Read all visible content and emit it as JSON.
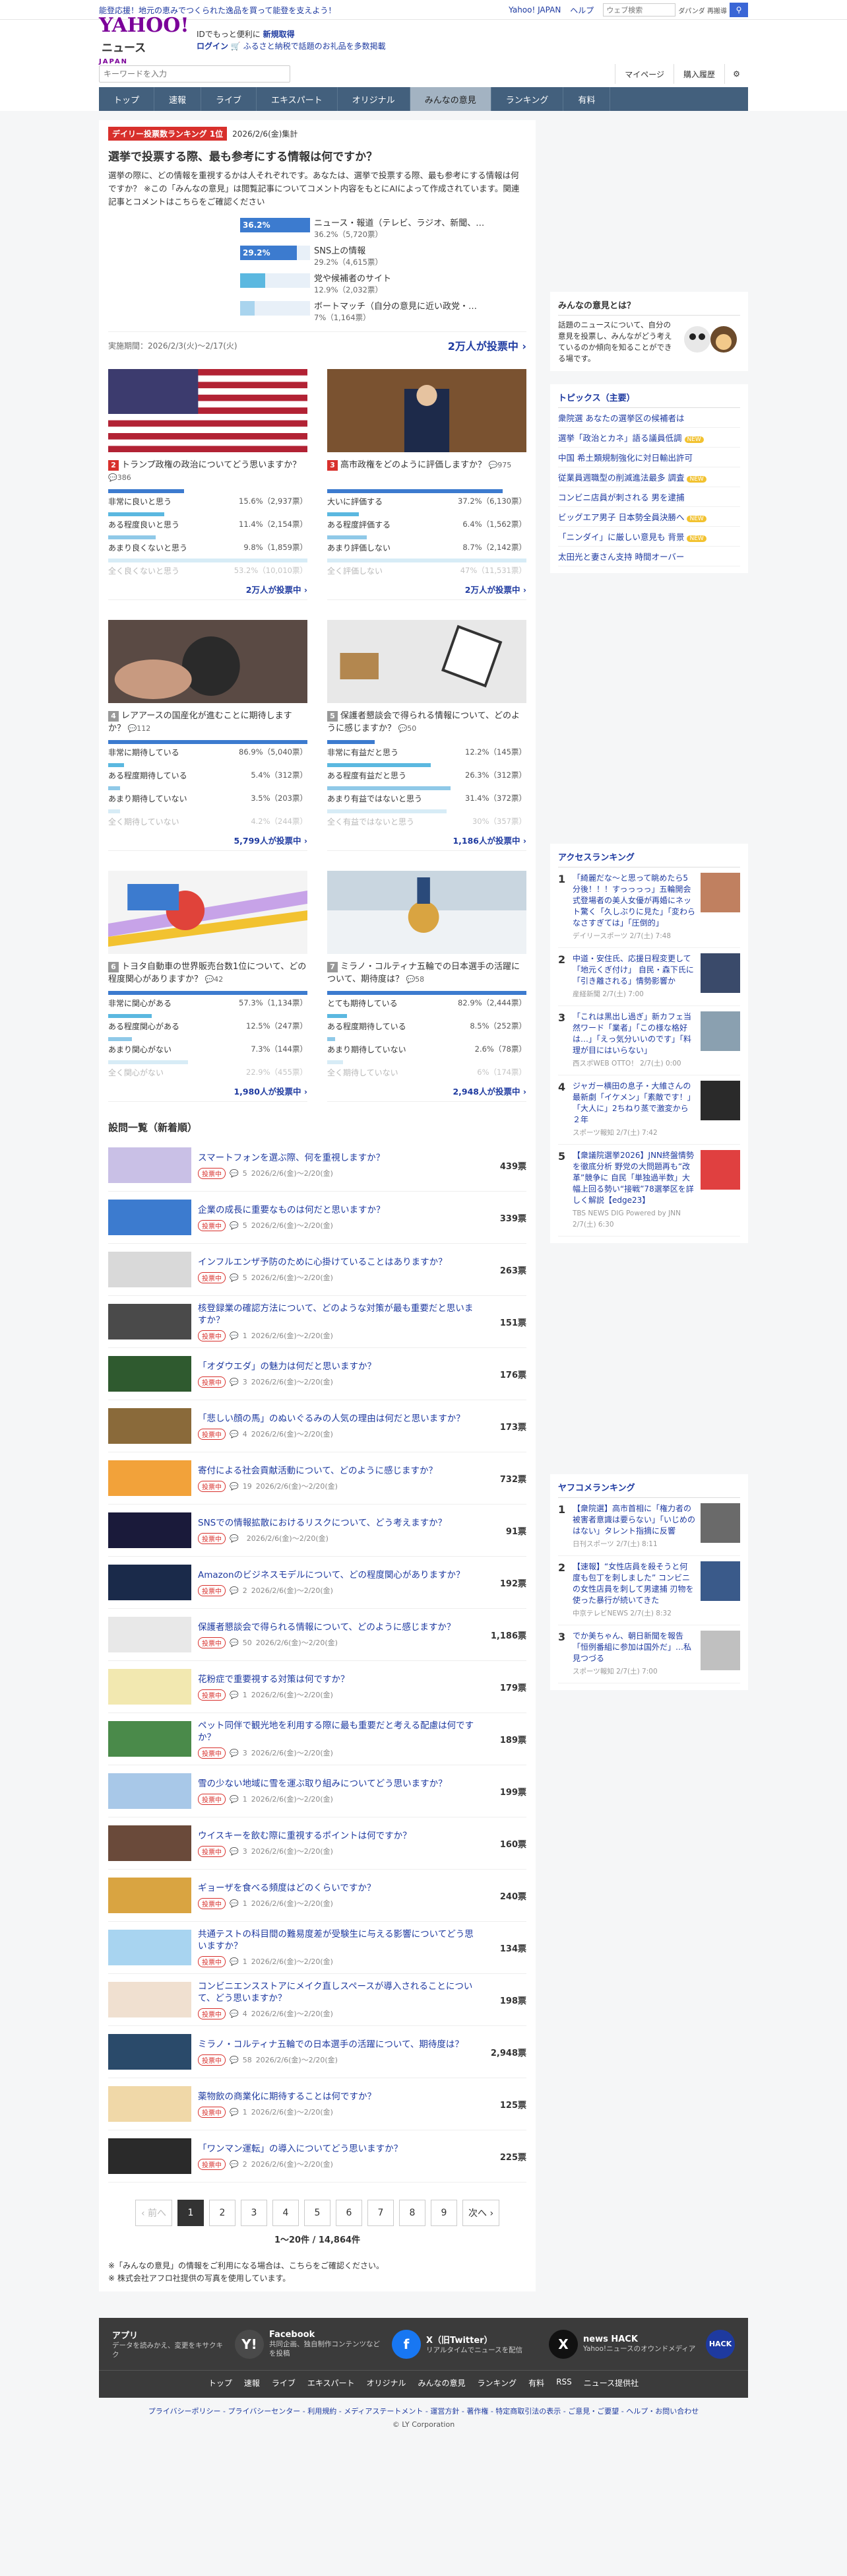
{
  "topbar": {
    "promo": "能登応援！地元の恵みでつくられた逸品を買って能登を支えよう！",
    "yahoo_japan": "Yahoo! JAPAN",
    "help": "ヘルプ",
    "search_placeholder": "ウェブ検索",
    "keyword": "ダパンダ 再搬導"
  },
  "header": {
    "logo_main": "YAHOO!",
    "logo_news": "ニュース",
    "logo_sub": "JAPAN",
    "tagline": "IDでもっと便利に",
    "signup": "新規取得",
    "login": "ログイン",
    "furusato": "ふるさと納税で話題のお礼品を多数掲載"
  },
  "search": {
    "placeholder": "キーワードを入力",
    "mypage": "マイページ",
    "history": "購入履歴"
  },
  "nav": [
    "トップ",
    "速報",
    "ライブ",
    "エキスパート",
    "オリジナル",
    "みんなの意見",
    "ランキング",
    "有料"
  ],
  "nav_active": 5,
  "featured": {
    "tag": "デイリー投票数ランキング 1位",
    "date": "2026/2/6(金)集計",
    "title": "選挙で投票する際、最も参考にする情報は何ですか？",
    "desc": "選挙の際に、どの情報を重視するかは人それぞれです。あなたは、選挙で投票する際、最も参考にする情報は何ですか？ ※この「みんなの意見」は閲覧記事についてコメント内容をもとにAIによって作成されています。関連記事とコメントはこちらをご確認ください",
    "options": [
      {
        "pct": "36.2%",
        "pct_num": 36.2,
        "label": "ニュース・報道（テレビ、ラジオ、新聞、…",
        "sub": "36.2%（5,720票）"
      },
      {
        "pct": "29.2%",
        "pct_num": 29.2,
        "label": "SNS上の情報",
        "sub": "29.2%（4,615票）"
      },
      {
        "pct": "",
        "pct_num": 12.9,
        "label": "党や候補者のサイト",
        "sub": "12.9%（2,032票）"
      },
      {
        "pct": "",
        "pct_num": 7.4,
        "label": "ボートマッチ（自分の意見に近い政党・…",
        "sub": "7%（1,164票）"
      }
    ],
    "period": "実施期間：2026/2/3(火)〜2/17(火)",
    "cta": "2万人が投票中 ›"
  },
  "cards": [
    {
      "num": "2",
      "title": "トランプ政権の政治についてどう思いますか？",
      "count": "386",
      "rows": [
        {
          "l": "非常に良いと思う",
          "p": "15.6%（2,937票）",
          "w": 38
        },
        {
          "l": "ある程度良いと思う",
          "p": "11.4%（2,154票）",
          "w": 28
        },
        {
          "l": "あまり良くないと思う",
          "p": "9.8%（1,859票）",
          "w": 24
        },
        {
          "l": "全く良くないと思う",
          "p": "53.2%（10,010票）",
          "w": 100
        }
      ],
      "cta": "2万人が投票中 ›"
    },
    {
      "num": "3",
      "title": "高市政権をどのように評価しますか？",
      "count": "975",
      "rows": [
        {
          "l": "大いに評価する",
          "p": "37.2%（6,130票）",
          "w": 88
        },
        {
          "l": "ある程度評価する",
          "p": "6.4%（1,562票）",
          "w": 16
        },
        {
          "l": "あまり評価しない",
          "p": "8.7%（2,142票）",
          "w": 20
        },
        {
          "l": "全く評価しない",
          "p": "47%（11,531票）",
          "w": 100
        }
      ],
      "cta": "2万人が投票中 ›"
    },
    {
      "num": "4",
      "title": "レアアースの国産化が進むことに期待しますか？",
      "count": "112",
      "rows": [
        {
          "l": "非常に期待している",
          "p": "86.9%（5,040票）",
          "w": 100
        },
        {
          "l": "ある程度期待している",
          "p": "5.4%（312票）",
          "w": 8
        },
        {
          "l": "あまり期待していない",
          "p": "3.5%（203票）",
          "w": 6
        },
        {
          "l": "全く期待していない",
          "p": "4.2%（244票）",
          "w": 6
        }
      ],
      "cta": "5,799人が投票中 ›"
    },
    {
      "num": "5",
      "title": "保護者懇談会で得られる情報について、どのように感じますか？",
      "count": "50",
      "rows": [
        {
          "l": "非常に有益だと思う",
          "p": "12.2%（145票）",
          "w": 24
        },
        {
          "l": "ある程度有益だと思う",
          "p": "26.3%（312票）",
          "w": 52
        },
        {
          "l": "あまり有益ではないと思う",
          "p": "31.4%（372票）",
          "w": 62
        },
        {
          "l": "全く有益ではないと思う",
          "p": "30%（357票）",
          "w": 60
        }
      ],
      "cta": "1,186人が投票中 ›"
    },
    {
      "num": "6",
      "title": "トヨタ自動車の世界販売台数1位について、どの程度関心がありますか？",
      "count": "42",
      "rows": [
        {
          "l": "非常に関心がある",
          "p": "57.3%（1,134票）",
          "w": 100
        },
        {
          "l": "ある程度関心がある",
          "p": "12.5%（247票）",
          "w": 22
        },
        {
          "l": "あまり関心がない",
          "p": "7.3%（144票）",
          "w": 12
        },
        {
          "l": "全く関心がない",
          "p": "22.9%（455票）",
          "w": 40
        }
      ],
      "cta": "1,980人が投票中 ›"
    },
    {
      "num": "7",
      "title": "ミラノ・コルティナ五輪での日本選手の活躍について、期待度は？",
      "count": "58",
      "rows": [
        {
          "l": "とても期待している",
          "p": "82.9%（2,444票）",
          "w": 100
        },
        {
          "l": "ある程度期待している",
          "p": "8.5%（252票）",
          "w": 10
        },
        {
          "l": "あまり期待していない",
          "p": "2.6%（78票）",
          "w": 4
        },
        {
          "l": "全く期待していない",
          "p": "6%（174票）",
          "w": 8
        }
      ],
      "cta": "2,948人が投票中 ›"
    }
  ],
  "list_heading": "設問一覧（新着順）",
  "badge": "投票中",
  "list": [
    {
      "t": "スマートフォンを選ぶ際、何を重視しますか？",
      "c": "5",
      "d": "2026/2/6(金)〜2/20(金)",
      "v": "439票"
    },
    {
      "t": "企業の成長に重要なものは何だと思いますか？",
      "c": "5",
      "d": "2026/2/6(金)〜2/20(金)",
      "v": "339票"
    },
    {
      "t": "インフルエンザ予防のために心掛けていることはありますか？",
      "c": "5",
      "d": "2026/2/6(金)〜2/20(金)",
      "v": "263票"
    },
    {
      "t": "核登録業の確認方法について、どのような対策が最も重要だと思いますか？",
      "c": "1",
      "d": "2026/2/6(金)〜2/20(金)",
      "v": "151票"
    },
    {
      "t": "「オダウエダ」の魅力は何だと思いますか？",
      "c": "3",
      "d": "2026/2/6(金)〜2/20(金)",
      "v": "176票"
    },
    {
      "t": "「悲しい顔の馬」のぬいぐるみの人気の理由は何だと思いますか？",
      "c": "4",
      "d": "2026/2/6(金)〜2/20(金)",
      "v": "173票"
    },
    {
      "t": "寄付による社会貢献活動について、どのように感じますか？",
      "c": "19",
      "d": "2026/2/6(金)〜2/20(金)",
      "v": "732票"
    },
    {
      "t": "SNSでの情報拡散におけるリスクについて、どう考えますか？",
      "c": "",
      "d": "2026/2/6(金)〜2/20(金)",
      "v": "91票"
    },
    {
      "t": "Amazonのビジネスモデルについて、どの程度関心がありますか？",
      "c": "2",
      "d": "2026/2/6(金)〜2/20(金)",
      "v": "192票"
    },
    {
      "t": "保護者懇談会で得られる情報について、どのように感じますか？",
      "c": "50",
      "d": "2026/2/6(金)〜2/20(金)",
      "v": "1,186票"
    },
    {
      "t": "花粉症で重要視する対策は何ですか？",
      "c": "1",
      "d": "2026/2/6(金)〜2/20(金)",
      "v": "179票"
    },
    {
      "t": "ペット同伴で観光地を利用する際に最も重要だと考える配慮は何ですか？",
      "c": "3",
      "d": "2026/2/6(金)〜2/20(金)",
      "v": "189票"
    },
    {
      "t": "雪の少ない地域に雪を運ぶ取り組みについてどう思いますか？",
      "c": "1",
      "d": "2026/2/6(金)〜2/20(金)",
      "v": "199票"
    },
    {
      "t": "ウイスキーを飲む際に重視するポイントは何ですか？",
      "c": "3",
      "d": "2026/2/6(金)〜2/20(金)",
      "v": "160票"
    },
    {
      "t": "ギョーザを食べる頻度はどのくらいですか？",
      "c": "1",
      "d": "2026/2/6(金)〜2/20(金)",
      "v": "240票"
    },
    {
      "t": "共通テストの科目間の難易度差が受験生に与える影響についてどう思いますか？",
      "c": "1",
      "d": "2026/2/6(金)〜2/20(金)",
      "v": "134票"
    },
    {
      "t": "コンビニエンスストアにメイク直しスペースが導入されることについて、どう思いますか？",
      "c": "4",
      "d": "2026/2/6(金)〜2/20(金)",
      "v": "198票"
    },
    {
      "t": "ミラノ・コルティナ五輪での日本選手の活躍について、期待度は？",
      "c": "58",
      "d": "2026/2/6(金)〜2/20(金)",
      "v": "2,948票"
    },
    {
      "t": "薬物飲の商業化に期待することは何ですか？",
      "c": "1",
      "d": "2026/2/6(金)〜2/20(金)",
      "v": "125票"
    },
    {
      "t": "「ワンマン運転」の導入についてどう思いますか？",
      "c": "2",
      "d": "2026/2/6(金)〜2/20(金)",
      "v": "225票"
    }
  ],
  "pager": {
    "prev": "‹ 前へ",
    "pages": [
      "1",
      "2",
      "3",
      "4",
      "5",
      "6",
      "7",
      "8",
      "9"
    ],
    "next": "次へ ›",
    "info": "1〜20件 / 14,864件"
  },
  "notes": [
    "※「みんなの意見」の情報をご利用になる場合は、こちらをご確認ください。",
    "※ 株式会社アフロ社提供の写真を使用しています。"
  ],
  "side": {
    "about_h": "みんなの意見とは？",
    "about": "話題のニュースについて、自分の意見を投票し、みんながどう考えているのか傾向を知ることができる場です。",
    "topics_h": "トピックス（主要）",
    "topics": [
      "衆院選 あなたの選挙区の候補者は",
      "選挙「政治とカネ」語る議員低調",
      "中国 希土類規制強化に対日輸出許可",
      "従業員週職型の削減進法最多 調査",
      "コンビニ店員が刺される 男を逮捕",
      "ビッグエア男子 日本勢全員決勝へ",
      "「ニンダイ」に厳しい意見も 背景",
      "太田光と妻さん支持 時間オーバー"
    ],
    "topic_new": "NEW",
    "access_h": "アクセスランキング",
    "access": [
      {
        "n": "1",
        "t": "「綺麗だな〜と思って眺めたら5分後！！！すっっっっ」五輪開会式登場者の美人女優が再婚にネット驚く「久しぶりに見た」「変わらなさすぎては」「圧倒的」",
        "s": "デイリースポーツ 2/7(土) 7:48"
      },
      {
        "n": "2",
        "t": "中道・安住氏、応援日程変更して「地元くぎ付け」 自民・森下氏に「引き離される」情勢影響か",
        "s": "産経新聞 2/7(土) 7:00"
      },
      {
        "n": "3",
        "t": "「これは黒出し過ぎ」新カフェ当然ワード「業者」「この様な格好は…」「えっ気分いいのです」「料理が目にはいらない」",
        "s": "西スポWEB OTTO！ 2/7(土) 0:00"
      },
      {
        "n": "4",
        "t": "ジャガー横田の息子・大維さんの最新劇「イケメン」「素敵です！」「大人に」2ちねり蒸で激変から２年",
        "s": "スポーツ報知 2/7(土) 7:42"
      },
      {
        "n": "5",
        "t": "【衆議院選挙2026】JNN終盤情勢を徹底分析 野党の大問題再も“改革”競争に 自民「単独過半数」大幅上回る勢い“接戦”78選挙区を詳しく解説【edge23】",
        "s": "TBS NEWS DIG Powered by JNN 2/7(土) 6:30"
      }
    ],
    "yafoo_h": "ヤフコメランキング",
    "yafoo": [
      {
        "n": "1",
        "t": "【衆院選】高市首相に「権力者の被害者意識は要らない」「いじめのはない」タレント指摘に反響",
        "s": "日刊スポーツ 2/7(土) 8:11"
      },
      {
        "n": "2",
        "t": "【速報】“女性店員を殺そうと何度も包丁を刺しました” コンビニの女性店員を刺して男逮捕 刃物を使った暴行が続いてきた",
        "s": "中京テレビNEWS 2/7(土) 8:32"
      },
      {
        "n": "3",
        "t": "でか美ちゃん、朝日新聞を報告「恒例番組に参加は国外だ」…私見つづる",
        "s": "スポーツ報知 2/7(土) 7:00"
      }
    ]
  },
  "footer": {
    "apps": [
      {
        "t": "アプリ",
        "d": "データを読みかえ、変更をキサクキク",
        "ic": "Y!"
      },
      {
        "t": "Facebook",
        "d": "共同企画、独自制作コンテンツなどを投稿",
        "ic": "f"
      },
      {
        "t": "X（旧Twitter）",
        "d": "リアルタイムでニュースを配信",
        "ic": "X"
      },
      {
        "t": "news HACK",
        "d": "Yahoo!ニュースのオウンドメディア",
        "ic": "HACK"
      }
    ],
    "nav": [
      "トップ",
      "速報",
      "ライブ",
      "エキスパート",
      "オリジナル",
      "みんなの意見",
      "ランキング",
      "有料",
      "RSS",
      "ニュース提供社"
    ],
    "bottom": "プライバシーポリシー - プライバシーセンター - 利用規約 - メディアステートメント - 運営方針 - 著作権 - 特定商取引法の表示 - ご意見・ご要望 - ヘルプ・お問い合わせ",
    "copy": "© LY Corporation"
  }
}
